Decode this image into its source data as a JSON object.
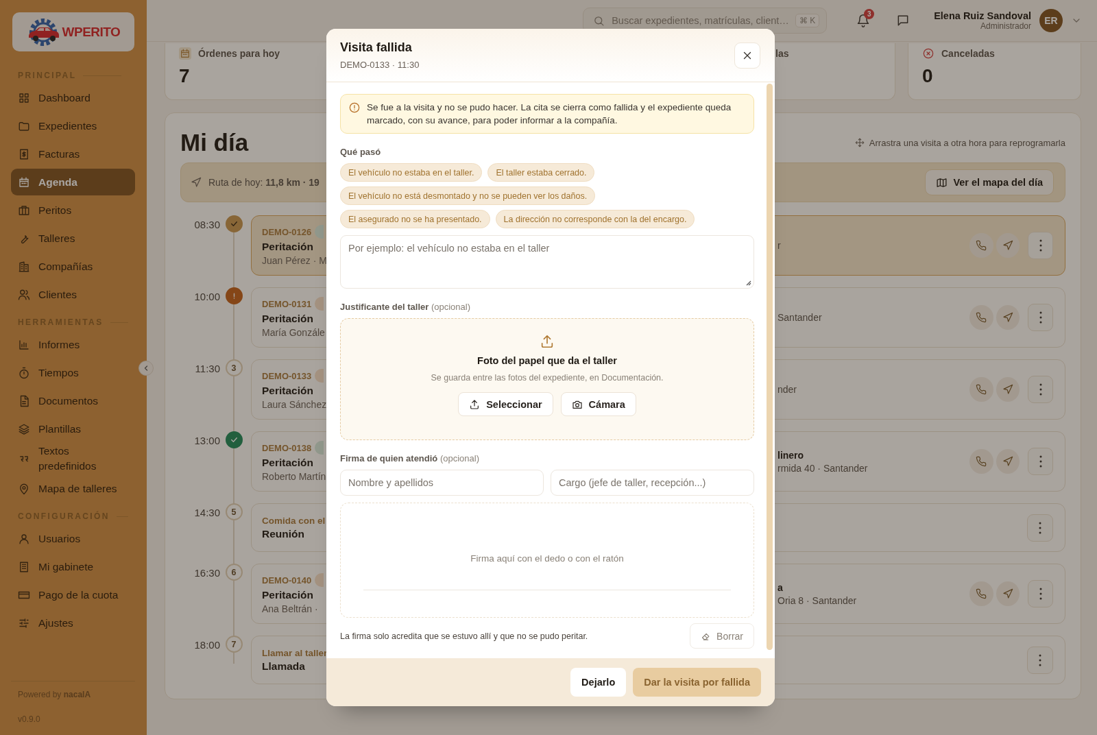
{
  "logo": {
    "text": "WPERITO"
  },
  "sidebar": {
    "sections": [
      {
        "title": "PRINCIPAL",
        "items": [
          {
            "label": "Dashboard",
            "selected": false
          },
          {
            "label": "Expedientes",
            "selected": false
          },
          {
            "label": "Facturas",
            "selected": false
          },
          {
            "label": "Agenda",
            "selected": true
          },
          {
            "label": "Peritos",
            "selected": false
          },
          {
            "label": "Talleres",
            "selected": false
          },
          {
            "label": "Compañías",
            "selected": false
          },
          {
            "label": "Clientes",
            "selected": false
          }
        ]
      },
      {
        "title": "HERRAMIENTAS",
        "items": [
          {
            "label": "Informes",
            "selected": false
          },
          {
            "label": "Tiempos",
            "selected": false
          },
          {
            "label": "Documentos",
            "selected": false
          },
          {
            "label": "Plantillas",
            "selected": false
          },
          {
            "label": "Textos predefinidos",
            "selected": false
          },
          {
            "label": "Mapa de talleres",
            "selected": false
          }
        ]
      },
      {
        "title": "CONFIGURACIÓN",
        "items": [
          {
            "label": "Usuarios",
            "selected": false
          },
          {
            "label": "Mi gabinete",
            "selected": false
          },
          {
            "label": "Pago de la cuota",
            "selected": false
          },
          {
            "label": "Ajustes",
            "selected": false
          }
        ]
      }
    ],
    "powered_by": "Powered by **nacalA**",
    "version": "v0.9.0"
  },
  "topbar": {
    "search": {
      "placeholder": "Buscar expedientes, matrículas, client…",
      "shortcut": "⌘ K"
    },
    "notifications": "3",
    "user": {
      "name": "Elena Ruiz Sandoval",
      "role": "Administrador",
      "initials": "ER"
    }
  },
  "stats": [
    {
      "kind": "today",
      "label": "Órdenes para hoy",
      "value": "7"
    },
    {
      "kind": "partial",
      "label": "las"
    },
    {
      "kind": "cancelled",
      "label": "Canceladas",
      "value": "0"
    }
  ],
  "day": {
    "title": "Mi día",
    "hint": "Arrastra una visita a otra hora para reprogramarla",
    "route": "Ruta de hoy: **11,8 km · 19**",
    "map_button": "Ver el mapa del día",
    "rows": [
      {
        "kind": "visit",
        "time": "08:30",
        "marker": {
          "kind": "done"
        },
        "highlighted": true,
        "id": "DEMO-0126",
        "tag": {
          "color": "#91988c"
        },
        "title": "Peritación",
        "person": "Juan Pérez · M",
        "location": "r"
      },
      {
        "kind": "visit",
        "time": "10:00",
        "marker": {
          "kind": "alert"
        },
        "highlighted": false,
        "id": "DEMO-0131",
        "tag": {
          "color": "#a49280"
        },
        "title": "Peritación",
        "person": "María Gonzále",
        "location": "Santander"
      },
      {
        "kind": "visit",
        "time": "11:30",
        "marker": {
          "kind": "number",
          "number": "3"
        },
        "highlighted": false,
        "id": "DEMO-0133",
        "tag": {
          "color": "#a49280"
        },
        "title": "Peritación",
        "person": "Laura Sánchez",
        "location": "nder"
      },
      {
        "kind": "visit",
        "time": "13:00",
        "marker": {
          "kind": "completed"
        },
        "highlighted": false,
        "id": "DEMO-0138",
        "tag": {
          "color": "#91988c"
        },
        "title": "Peritación",
        "person": "Roberto Martín",
        "place": "linero",
        "location": "rmida 40 · Santander"
      },
      {
        "kind": "event",
        "time": "14:30",
        "marker": {
          "kind": "number",
          "number": "5"
        },
        "highlighted": false,
        "subject": "Comida con el",
        "title": "Reunión"
      },
      {
        "kind": "visit",
        "time": "16:30",
        "marker": {
          "kind": "number",
          "number": "6"
        },
        "highlighted": false,
        "id": "DEMO-0140",
        "tag": {
          "color": "#a49280"
        },
        "title": "Peritación",
        "person": "Ana Beltrán ·",
        "place": "a",
        "location": "Oria 8 · Santander"
      },
      {
        "kind": "event",
        "time": "18:00",
        "marker": {
          "kind": "number",
          "number": "7"
        },
        "highlighted": false,
        "subject": "Llamar al taller",
        "title": "Llamada"
      }
    ]
  },
  "dialog": {
    "title": "Visita fallida",
    "subtitle": "DEMO-0133 · 11:30",
    "notice": "Se fue a la visita y no se pudo hacer. La cita se cierra como fallida y el expediente queda marcado, con su avance, para poder informar a la compañía.",
    "reasons_label": "Qué pasó",
    "reasons": [
      {
        "label": "El vehículo no estaba en el taller.",
        "selected": false
      },
      {
        "label": "El taller estaba cerrado.",
        "selected": false
      },
      {
        "label": "El vehículo no está desmontado y no se pueden ver los daños.",
        "selected": false
      },
      {
        "label": "El asegurado no se ha presentado.",
        "selected": false
      },
      {
        "label": "La dirección no corresponde con la del encargo.",
        "selected": false
      }
    ],
    "description": {
      "placeholder": "Por ejemplo: el vehículo no estaba en el taller"
    },
    "receipt": {
      "label": "Justificante del taller",
      "optional": "(opcional)",
      "title": "Foto del papel que da el taller",
      "hint": "Se guarda entre las fotos del expediente, en Documentación.",
      "select_button": "Seleccionar",
      "camera_button": "Cámara"
    },
    "signature": {
      "label": "Firma de quien atendió",
      "optional": "(opcional)",
      "name_placeholder": "Nombre y apellidos",
      "role_placeholder": "Cargo (jefe de taller, recepción...)",
      "pad_hint": "Firma aquí con el dedo o con el ratón",
      "note": "La firma solo acredita que se estuvo allí y que no se pudo peritar.",
      "clear_button": "Borrar"
    },
    "cancel_button": "Dejarlo",
    "confirm_button": {
      "label": "Dar la visita por fallida",
      "disabled": true
    }
  }
}
